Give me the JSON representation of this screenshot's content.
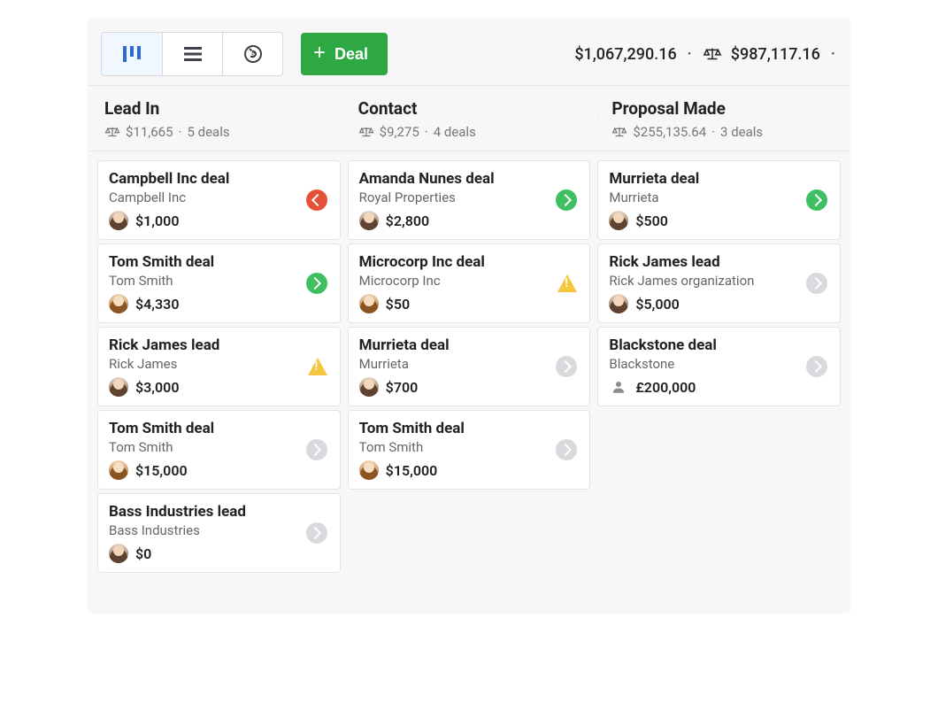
{
  "toolbar": {
    "add_deal_label": "Deal",
    "total1": "$1,067,290.16",
    "total2": "$987,117.16"
  },
  "stages": [
    {
      "title": "Lead In",
      "amount": "$11,665",
      "count": "5 deals"
    },
    {
      "title": "Contact",
      "amount": "$9,275",
      "count": "4 deals"
    },
    {
      "title": "Proposal Made",
      "amount": "$255,135.64",
      "count": "3 deals"
    }
  ],
  "cards": {
    "s0": [
      {
        "title": "Campbell Inc deal",
        "org": "Campbell Inc",
        "amount": "$1,000",
        "avatar": "av1",
        "status": "red-left"
      },
      {
        "title": "Tom Smith deal",
        "org": "Tom Smith",
        "amount": "$4,330",
        "avatar": "av2",
        "status": "green"
      },
      {
        "title": "Rick James lead",
        "org": "Rick James",
        "amount": "$3,000",
        "avatar": "av1",
        "status": "warn"
      },
      {
        "title": "Tom Smith deal",
        "org": "Tom Smith",
        "amount": "$15,000",
        "avatar": "av2",
        "status": "gray"
      },
      {
        "title": "Bass Industries lead",
        "org": "Bass Industries",
        "amount": "$0",
        "avatar": "av1",
        "status": "gray"
      }
    ],
    "s1": [
      {
        "title": "Amanda Nunes deal",
        "org": "Royal Properties",
        "amount": "$2,800",
        "avatar": "av1",
        "status": "green"
      },
      {
        "title": "Microcorp Inc deal",
        "org": "Microcorp Inc",
        "amount": "$50",
        "avatar": "av2",
        "status": "warn"
      },
      {
        "title": "Murrieta deal",
        "org": "Murrieta",
        "amount": "$700",
        "avatar": "av1",
        "status": "gray"
      },
      {
        "title": "Tom Smith deal",
        "org": "Tom Smith",
        "amount": "$15,000",
        "avatar": "av2",
        "status": "gray"
      }
    ],
    "s2": [
      {
        "title": "Murrieta deal",
        "org": "Murrieta",
        "amount": "$500",
        "avatar": "av1",
        "status": "green"
      },
      {
        "title": "Rick James lead",
        "org": "Rick James organization",
        "amount": "$5,000",
        "avatar": "av1",
        "status": "gray"
      },
      {
        "title": "Blackstone deal",
        "org": "Blackstone",
        "amount": "£200,000",
        "avatar": "generic",
        "status": "gray"
      }
    ]
  }
}
